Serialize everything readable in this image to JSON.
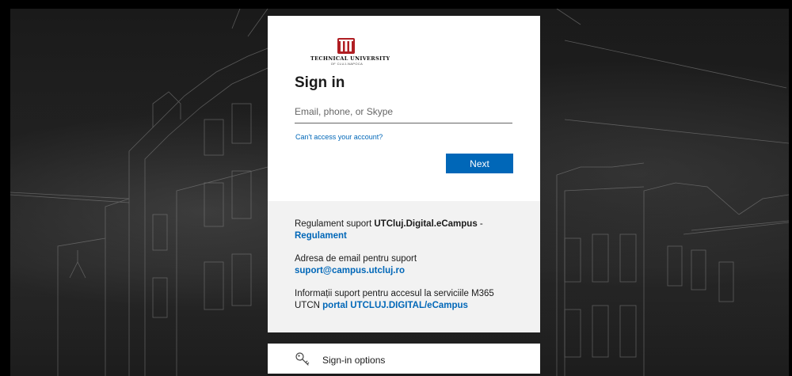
{
  "logo": {
    "name": "TECHNICAL UNIVERSITY",
    "subtitle": "OF CLUJ-NAPOCA"
  },
  "signin": {
    "title": "Sign in",
    "email_placeholder": "Email, phone, or Skype",
    "cant_access_link": "Can't access your account?",
    "next_button": "Next"
  },
  "info": {
    "reg_prefix": "Regulament suport ",
    "reg_bold": "UTCluj.Digital.eCampus",
    "reg_sep": " -",
    "reg_link": "Regulament",
    "email_label": "Adresa de email pentru suport",
    "email_link": "suport@campus.utcluj.ro",
    "m365_text": "Informații suport pentru accesul la serviciile M365 UTCN ",
    "m365_link": "portal UTCLUJ.DIGITAL/eCampus"
  },
  "signin_options": {
    "label": "Sign-in options",
    "icon": "key-icon"
  },
  "colors": {
    "accent": "#0067b8",
    "card_bg": "#ffffff",
    "footer_bg": "#f2f2f2",
    "logo_red": "#b01e23"
  }
}
